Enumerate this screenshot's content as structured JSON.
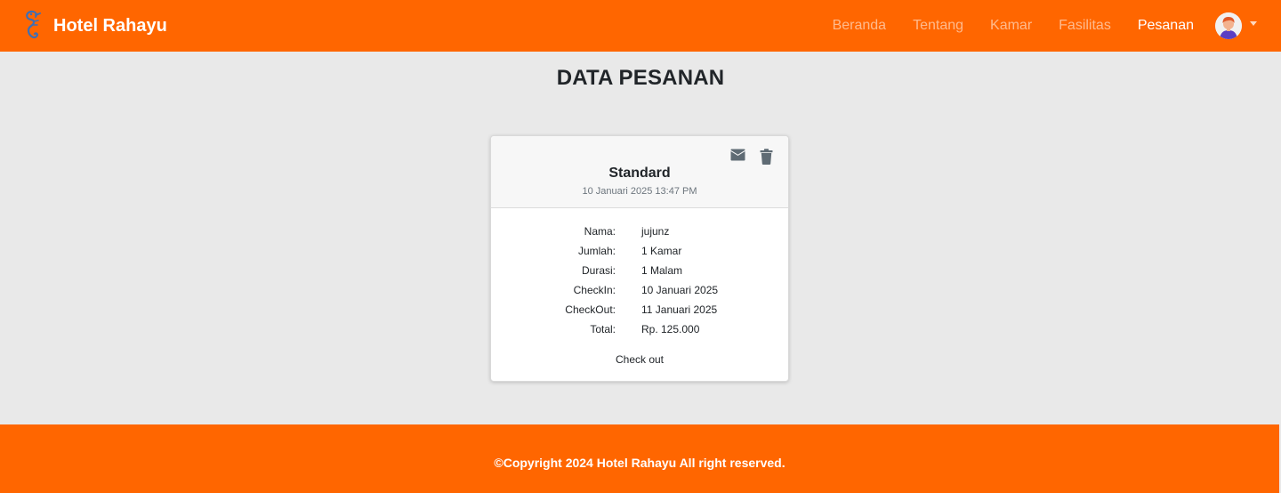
{
  "brand": {
    "name": "Hotel Rahayu",
    "logo_icon": "seahorse-logo-icon"
  },
  "nav": {
    "links": [
      "Beranda",
      "Tentang",
      "Kamar",
      "Fasilitas",
      "Pesanan"
    ],
    "active": "Pesanan",
    "avatar_icon": "user-avatar-icon"
  },
  "page": {
    "title": "DATA PESANAN"
  },
  "booking": {
    "room": "Standard",
    "datetime": "10 Januari 2025  13:47 PM",
    "actions": {
      "email_icon": "envelope-icon",
      "delete_icon": "trash-icon"
    },
    "fields": [
      {
        "label": "Nama:",
        "value": "jujunz"
      },
      {
        "label": "Jumlah:",
        "value": "1 Kamar"
      },
      {
        "label": "Durasi:",
        "value": "1 Malam"
      },
      {
        "label": "CheckIn:",
        "value": "10 Januari 2025"
      },
      {
        "label": "CheckOut:",
        "value": "11 Januari 2025"
      },
      {
        "label": "Total:",
        "value": "Rp. 125.000"
      }
    ],
    "status": "Check out"
  },
  "footer": {
    "text": "©Copyright 2024 Hotel Rahayu All right reserved."
  },
  "colors": {
    "primary": "#ff6600",
    "background": "#e9e9e9"
  }
}
